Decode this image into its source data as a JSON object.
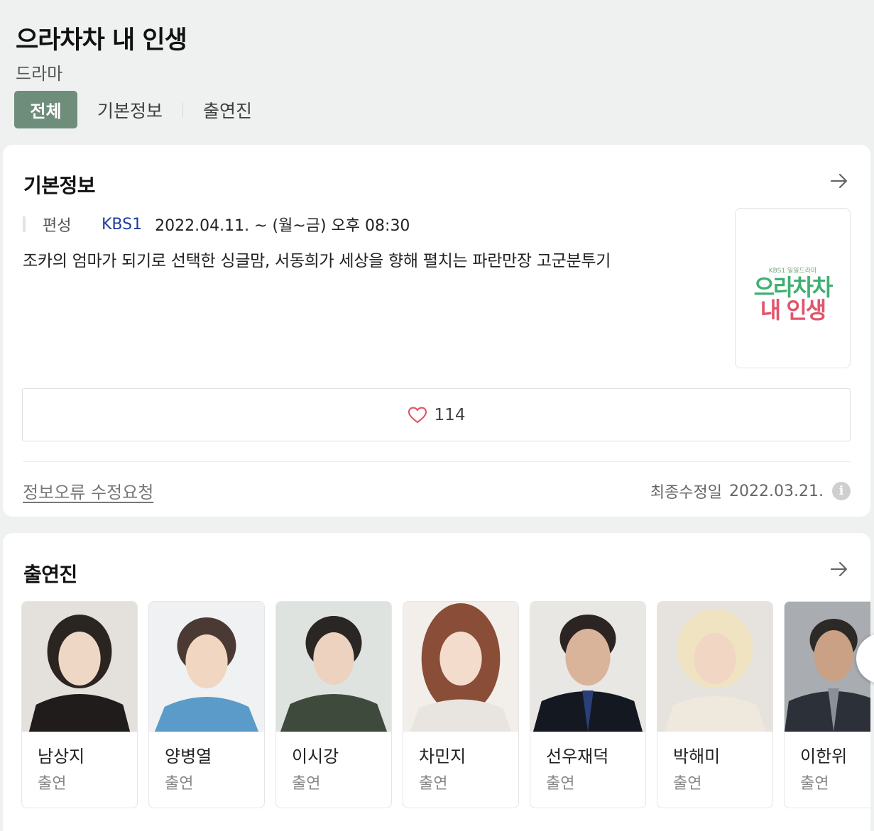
{
  "header": {
    "title": "으라차차 내 인생",
    "subtitle": "드라마",
    "tabs": [
      "전체",
      "기본정보",
      "출연진"
    ]
  },
  "info": {
    "section_title": "기본정보",
    "meta_label": "편성",
    "network": "KBS1",
    "schedule": "2022.04.11. ~  (월~금) 오후 08:30",
    "description": "조카의 엄마가 되기로 선택한 싱글맘, 서동희가 세상을 향해 펼치는 파란만장 고군분투기",
    "poster": {
      "small_text": "KBS1 일일드라마",
      "line1": "으라차차",
      "line2": "내 인생"
    },
    "likes": "114",
    "report_link": "정보오류 수정요청",
    "updated_label": "최종수정일",
    "updated_date": "2022.03.21.",
    "info_icon": "i"
  },
  "cast": {
    "section_title": "출연진",
    "members": [
      {
        "name": "남상지",
        "role": "출연"
      },
      {
        "name": "양병열",
        "role": "출연"
      },
      {
        "name": "이시강",
        "role": "출연"
      },
      {
        "name": "차민지",
        "role": "출연"
      },
      {
        "name": "선우재덕",
        "role": "출연"
      },
      {
        "name": "박해미",
        "role": "출연"
      },
      {
        "name": "이한위",
        "role": "출연"
      }
    ]
  },
  "icons": {
    "arrow": "arrow-right-icon",
    "heart": "heart-icon",
    "info": "info-icon"
  },
  "colors": {
    "accent": "#6f8d7b",
    "network": "#1d3e9a",
    "heart": "#e05a67"
  }
}
